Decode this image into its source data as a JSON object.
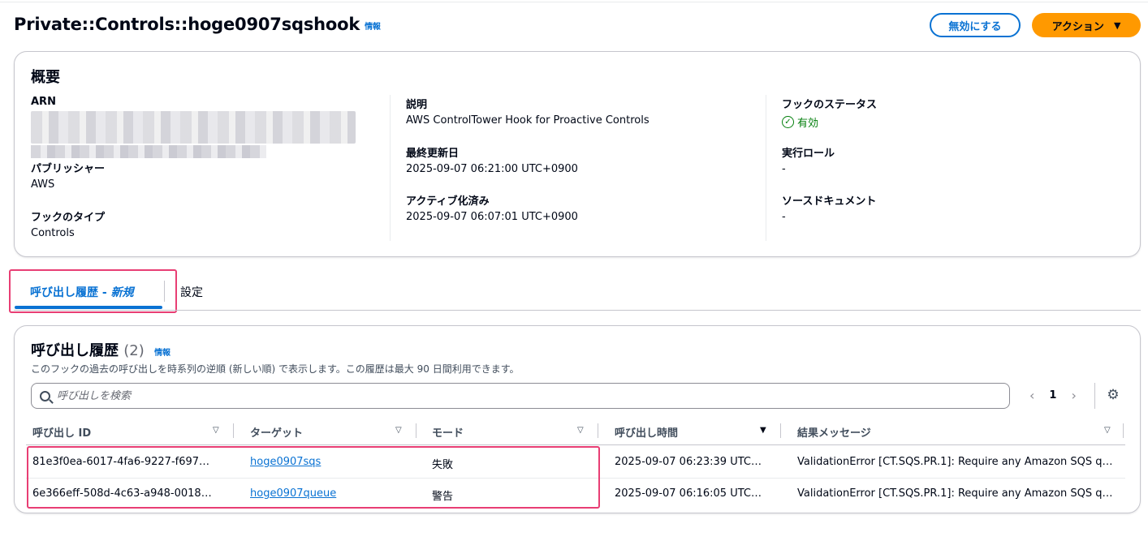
{
  "header": {
    "title": "Private::Controls::hoge0907sqshook",
    "info": "情報",
    "disable_button": "無効にする",
    "action_button": "アクション"
  },
  "overview": {
    "title": "概要",
    "arn_label": "ARN",
    "publisher_label": "パブリッシャー",
    "publisher_value": "AWS",
    "hook_type_label": "フックのタイプ",
    "hook_type_value": "Controls",
    "description_label": "説明",
    "description_value": "AWS ControlTower Hook for Proactive Controls",
    "last_updated_label": "最終更新日",
    "last_updated_value": "2025-09-07 06:21:00 UTC+0900",
    "activated_label": "アクティブ化済み",
    "activated_value": "2025-09-07 06:07:01 UTC+0900",
    "status_label": "フックのステータス",
    "status_value": "有効",
    "exec_role_label": "実行ロール",
    "exec_role_value": "-",
    "source_doc_label": "ソースドキュメント",
    "source_doc_value": "-"
  },
  "tabs": {
    "active_main": "呼び出し履歴 - ",
    "active_suffix": "新規",
    "settings": "設定"
  },
  "history": {
    "title": "呼び出し履歴",
    "count": "(2)",
    "info": "情報",
    "description": "このフックの過去の呼び出しを時系列の逆順 (新しい順) で表示します。この履歴は最大 90 日間利用できます。",
    "search_placeholder": "呼び出しを検索",
    "page": "1",
    "columns": [
      "呼び出し ID",
      "ターゲット",
      "モード",
      "呼び出し時間",
      "結果メッセージ"
    ],
    "rows": [
      {
        "id": "81e3f0ea-6017-4fa6-9227-f697…",
        "target": "hoge0907sqs",
        "mode": "失敗",
        "time": "2025-09-07 06:23:39 UTC…",
        "message": "ValidationError [CT.SQS.PR.1]: Require any Amazon SQS q…"
      },
      {
        "id": "6e366eff-508d-4c63-a948-0018…",
        "target": "hoge0907queue",
        "mode": "警告",
        "time": "2025-09-07 06:16:05 UTC…",
        "message": "ValidationError [CT.SQS.PR.1]: Require any Amazon SQS q…"
      }
    ]
  },
  "colors": {
    "accent": "#0972d3",
    "action": "#ff9900",
    "success": "#037f0c",
    "highlight": "#e83e74"
  }
}
